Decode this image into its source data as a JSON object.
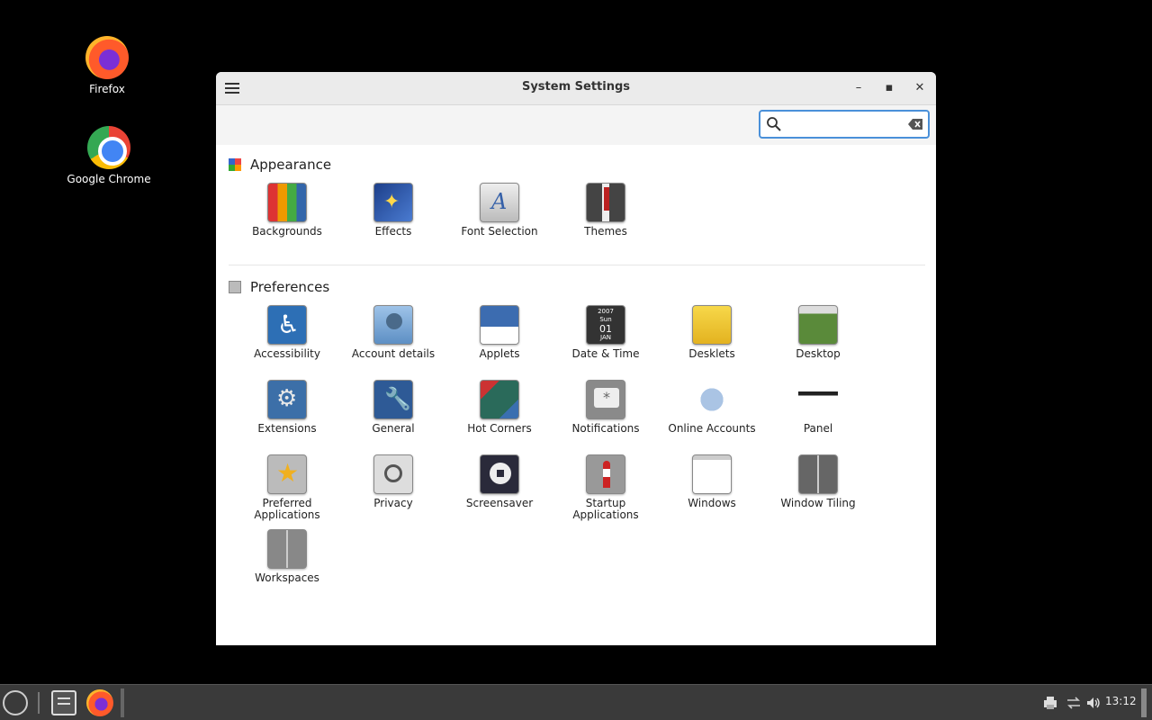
{
  "desktop": {
    "icons": [
      {
        "label": "Firefox"
      },
      {
        "label": "Google Chrome"
      }
    ]
  },
  "window": {
    "title": "System Settings",
    "search": {
      "value": "",
      "placeholder": ""
    },
    "sections": [
      {
        "title": "Appearance",
        "items": [
          "Backgrounds",
          "Effects",
          "Font Selection",
          "Themes"
        ]
      },
      {
        "title": "Preferences",
        "items": [
          "Accessibility",
          "Account details",
          "Applets",
          "Date & Time",
          "Desklets",
          "Desktop",
          "Extensions",
          "General",
          "Hot Corners",
          "Notifications",
          "Online Accounts",
          "Panel",
          "Preferred Applications",
          "Privacy",
          "Screensaver",
          "Startup Applications",
          "Windows",
          "Window Tiling",
          "Workspaces"
        ]
      }
    ],
    "date_icon": {
      "year": "2007",
      "day": "Sun",
      "date": "01",
      "month": "JAN"
    }
  },
  "taskbar": {
    "clock": "13:12"
  },
  "colors": {
    "accent": "#4a90d9",
    "taskbar": "#3a3a3a",
    "desktop": "#000000"
  }
}
